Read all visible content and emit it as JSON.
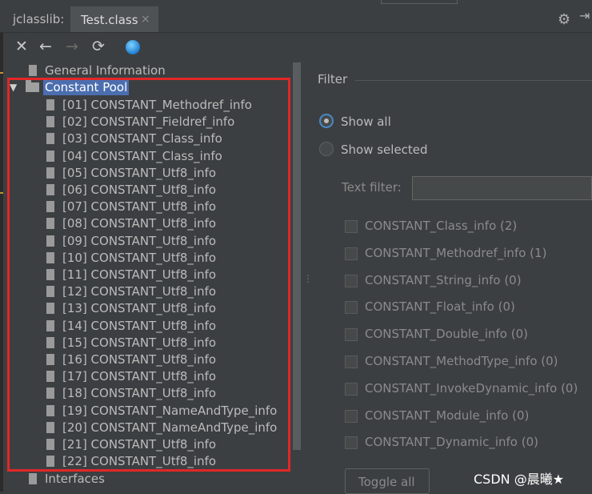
{
  "header": {
    "tool_title": "jclasslib:",
    "tab_label": "Test.class",
    "tab_close": "×"
  },
  "toolbar": {
    "close": "✕",
    "back": "←",
    "forward": "→",
    "refresh": "⟳",
    "gear": "⚙",
    "hide": "⇥"
  },
  "tree": {
    "general": "General Information",
    "constant_pool": "Constant Pool",
    "expand_arrow": "▼",
    "items": [
      "[01] CONSTANT_Methodref_info",
      "[02] CONSTANT_Fieldref_info",
      "[03] CONSTANT_Class_info",
      "[04] CONSTANT_Class_info",
      "[05] CONSTANT_Utf8_info",
      "[06] CONSTANT_Utf8_info",
      "[07] CONSTANT_Utf8_info",
      "[08] CONSTANT_Utf8_info",
      "[09] CONSTANT_Utf8_info",
      "[10] CONSTANT_Utf8_info",
      "[11] CONSTANT_Utf8_info",
      "[12] CONSTANT_Utf8_info",
      "[13] CONSTANT_Utf8_info",
      "[14] CONSTANT_Utf8_info",
      "[15] CONSTANT_Utf8_info",
      "[16] CONSTANT_Utf8_info",
      "[17] CONSTANT_Utf8_info",
      "[18] CONSTANT_Utf8_info",
      "[19] CONSTANT_NameAndType_info",
      "[20] CONSTANT_NameAndType_info",
      "[21] CONSTANT_Utf8_info",
      "[22] CONSTANT_Utf8_info"
    ],
    "interfaces": "Interfaces"
  },
  "filter": {
    "title": "Filter",
    "show_all": "Show all",
    "show_selected": "Show selected",
    "text_filter_label": "Text filter:",
    "text_filter_value": "",
    "checkboxes": [
      "CONSTANT_Class_info (2)",
      "CONSTANT_Methodref_info (1)",
      "CONSTANT_String_info (0)",
      "CONSTANT_Float_info (0)",
      "CONSTANT_Double_info (0)",
      "CONSTANT_MethodType_info (0)",
      "CONSTANT_InvokeDynamic_info (0)",
      "CONSTANT_Module_info (0)",
      "CONSTANT_Dynamic_info (0)"
    ],
    "toggle_all": "Toggle all"
  },
  "watermark": "CSDN @晨曦★"
}
